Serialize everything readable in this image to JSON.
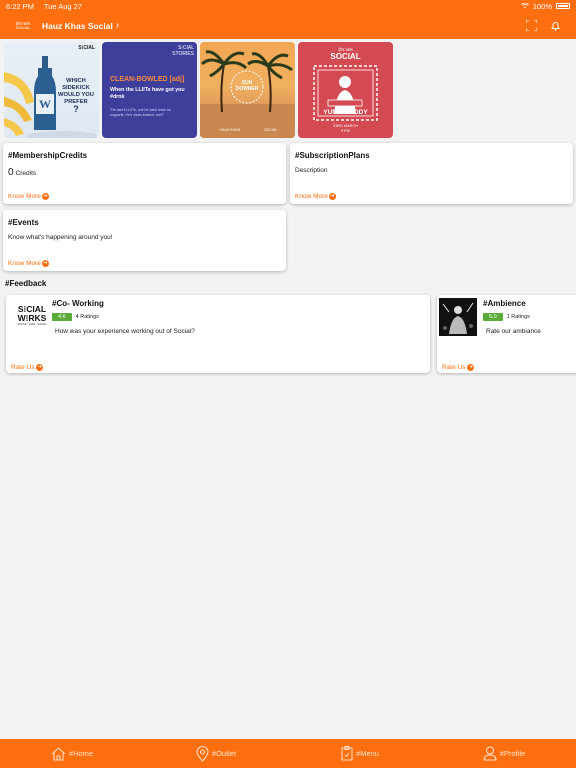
{
  "status": {
    "time": "6:22 PM",
    "date": "Tue Aug 27",
    "battery": "100%"
  },
  "header": {
    "logo_line1": "हौज खास",
    "logo_line2": "SOCIAL",
    "title": "Hauz Khas Social",
    "chevron": "›"
  },
  "banners": {
    "b1": {
      "brand": "S⁝CIAL",
      "text_line1": "WHICH",
      "text_line2": "SIDEKICK",
      "text_line3": "WOULD YOU",
      "text_line4": "PREFER",
      "qmark": "?"
    },
    "b2": {
      "brand_line1": "S⁝CIAL",
      "brand_line2": "STORIES",
      "headline": "CLEAN-BOWLED [adj]",
      "sub_line1": "When the LLIITs have got you",
      "sub_line2": "#drnk",
      "note_line1": "\"He had 4 LLIITs, one for each team he",
      "note_line2": "supports. He's clean-bowled, bro!!\""
    },
    "b3": {
      "badge_line1": "SUN",
      "badge_line2": "DOWNER",
      "footer_left": "HAUZ KHAS",
      "footer_right": "SOCIAL"
    },
    "b4": {
      "brand_top": "हौज खास",
      "brand_main": "SOCIAL",
      "name": "YUNG MADDY",
      "date": "23RD MARCH",
      "time": "9 PM"
    }
  },
  "cards": {
    "membership": {
      "title": "#MembershipCredits",
      "count": "0",
      "unit": "Credits",
      "link": "Know More"
    },
    "subscription": {
      "title": "#SubscriptionPlans",
      "desc": "Description",
      "link": "Know More"
    },
    "events": {
      "title": "#Events",
      "desc": "Know what's happening around you!",
      "link": "Know More"
    }
  },
  "feedback": {
    "label": "#Feedback",
    "items": [
      {
        "title": "#Co- Working",
        "logo_line1": "S⁝CIAL",
        "logo_line2": "W⁝RKS",
        "logo_line3": "OFFICE · CAFE · SOCIAL",
        "rating": "4.6",
        "ratings_count": "4 Ratings",
        "question": "How was your experience working out of Social?",
        "link": "Rate Us"
      },
      {
        "title": "#Ambience",
        "rating": "5.0",
        "ratings_count": "1 Ratings",
        "question": "Rate our ambiance",
        "link": "Rate Us"
      }
    ]
  },
  "tabs": [
    {
      "label": "#Home",
      "icon": "home-icon"
    },
    {
      "label": "#Outlet",
      "icon": "location-pin-icon"
    },
    {
      "label": "#Menu",
      "icon": "menu-clipboard-icon"
    },
    {
      "label": "#Profile",
      "icon": "profile-icon"
    }
  ],
  "colors": {
    "accent": "#ff6f0f",
    "rating": "#5cab3a",
    "background": "#f2f2f2"
  }
}
